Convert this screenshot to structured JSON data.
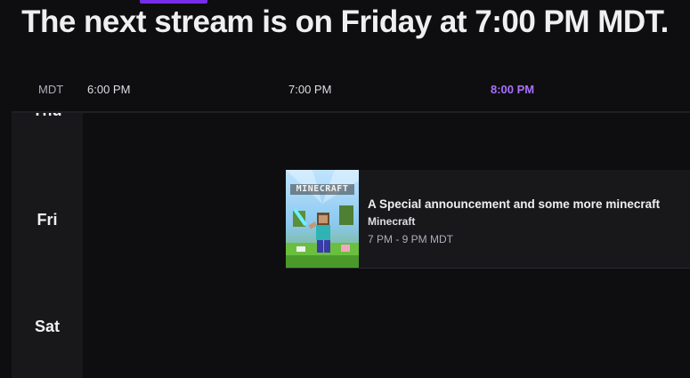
{
  "headline": "The next stream is on Friday at 7:00 PM MDT.",
  "timeline": {
    "timezone": "MDT",
    "ticks": [
      "6:00 PM",
      "7:00 PM",
      "8:00 PM"
    ]
  },
  "days": [
    "Thu",
    "Fri",
    "Sat"
  ],
  "event": {
    "title": "A Special announcement and some more minecraft",
    "game": "Minecraft",
    "time": "7 PM - 9 PM MDT",
    "cover_text": "MINECRAFT"
  },
  "colors": {
    "accent": "#a970ff",
    "tab_indicator": "#772ce8",
    "background": "#0e0e10",
    "panel": "#18181b"
  }
}
